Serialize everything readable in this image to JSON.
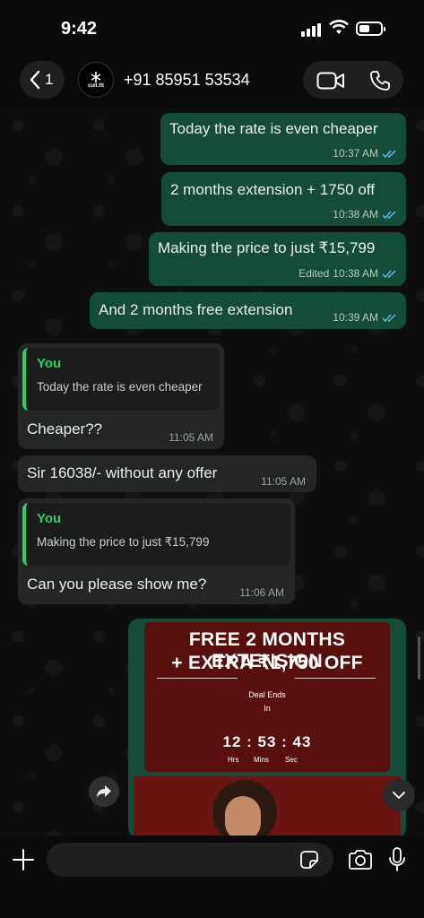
{
  "status_bar": {
    "time": "9:42"
  },
  "header": {
    "back_count": "1",
    "avatar_text": "cult.fit",
    "contact_name": "+91 85951 53534"
  },
  "messages": [
    {
      "text": "Today the rate is even cheaper",
      "time": "10:37 AM"
    },
    {
      "text": "2 months extension + 1750 off",
      "time": "10:38 AM"
    },
    {
      "text": "Making the price to just ₹15,799",
      "time": "10:38 AM",
      "edited_label": "Edited"
    },
    {
      "text": "And 2 months free extension",
      "time": "10:39 AM"
    },
    {
      "quote_author": "You",
      "quote_text": "Today the rate is even cheaper",
      "text": "Cheaper??",
      "time": "11:05 AM"
    },
    {
      "text": "Sir 16038/- without any offer",
      "time": "11:05 AM"
    },
    {
      "quote_author": "You",
      "quote_text": "Making the price to just ₹15,799",
      "text": "Can you please show me?",
      "time": "11:06 AM"
    }
  ],
  "promo": {
    "title_line1": "FREE 2 MONTHS EXTENSION",
    "title_line2": "+ EXTRA ₹1,750 OFF",
    "deal_label": "Deal Ends",
    "deal_in": "In",
    "timer": "12 : 53 : 43",
    "units": [
      "Hrs",
      "Mins",
      "Sec"
    ]
  },
  "colors": {
    "outgoing_bubble": "#144d37",
    "incoming_bubble": "#242626",
    "read_ticks": "#53bdeb",
    "quote_accent": "#25d366",
    "promo_bg": "#5a0f0f"
  },
  "icons": [
    "chevron-left-icon",
    "video-call-icon",
    "phone-icon",
    "forward-icon",
    "chevron-down-icon",
    "plus-icon",
    "sticker-icon",
    "camera-icon",
    "mic-icon",
    "double-check-icon"
  ]
}
